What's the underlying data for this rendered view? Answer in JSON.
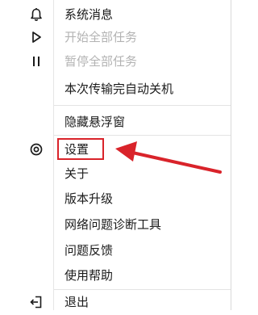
{
  "menu": {
    "items": [
      {
        "label": "系统消息",
        "icon": "bell-icon",
        "disabled": false
      },
      {
        "label": "开始全部任务",
        "icon": "play-icon",
        "disabled": true
      },
      {
        "label": "暂停全部任务",
        "icon": "pause-icon",
        "disabled": true
      },
      {
        "label": "本次传输完自动关机",
        "icon": "",
        "disabled": false
      },
      {
        "label": "隐藏悬浮窗",
        "icon": "",
        "disabled": false
      },
      {
        "label": "设置",
        "icon": "settings-icon",
        "disabled": false
      },
      {
        "label": "关于",
        "icon": "",
        "disabled": false
      },
      {
        "label": "版本升级",
        "icon": "",
        "disabled": false
      },
      {
        "label": "网络问题诊断工具",
        "icon": "",
        "disabled": false
      },
      {
        "label": "问题反馈",
        "icon": "",
        "disabled": false
      },
      {
        "label": "使用帮助",
        "icon": "",
        "disabled": false
      },
      {
        "label": "退出",
        "icon": "exit-icon",
        "disabled": false
      }
    ]
  },
  "annotation": {
    "highlighted_item": "设置",
    "highlight_color": "#d9232a"
  }
}
